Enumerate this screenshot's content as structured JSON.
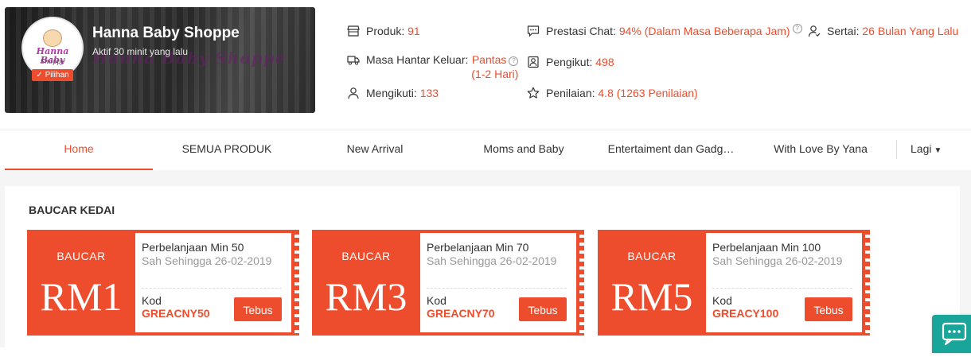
{
  "shop": {
    "name": "Hanna Baby Shoppe",
    "active_status": "Aktif 30 minit yang lalu",
    "badge": "Pilihan",
    "logo_text": "Hanna Baby",
    "logo_subtext": "Shoppe",
    "watermark": "Hanna Baby Shoppe"
  },
  "stats": {
    "products_label": "Produk:",
    "products_value": "91",
    "ship_label": "Masa Hantar Keluar:",
    "ship_value_1": "Pantas",
    "ship_value_2": "(1-2 Hari)",
    "following_label": "Mengikuti:",
    "following_value": "133",
    "chat_label": "Prestasi Chat:",
    "chat_value": "94% (Dalam Masa Beberapa Jam)",
    "followers_label": "Pengikut:",
    "followers_value": "498",
    "rating_label": "Penilaian:",
    "rating_value": "4.8 (1263 Penilaian)",
    "joined_label": "Sertai:",
    "joined_value": "26 Bulan Yang Lalu",
    "help_glyph": "?"
  },
  "nav": {
    "items": [
      "Home",
      "SEMUA PRODUK",
      "New Arrival",
      "Moms and Baby",
      "Entertaiment dan Gadg…",
      "With Love By Yana"
    ],
    "more": "Lagi",
    "more_caret": "▼"
  },
  "section": {
    "title": "BAUCAR KEDAI"
  },
  "vouchers": [
    {
      "label": "BAUCAR",
      "amount": "RM1",
      "min": "Perbelanjaan Min 50",
      "expiry": "Sah Sehingga 26-02-2019",
      "code_label": "Kod",
      "code": "GREACNY50",
      "button": "Tebus"
    },
    {
      "label": "BAUCAR",
      "amount": "RM3",
      "min": "Perbelanjaan Min 70",
      "expiry": "Sah Sehingga 26-02-2019",
      "code_label": "Kod",
      "code": "GREACNY70",
      "button": "Tebus"
    },
    {
      "label": "BAUCAR",
      "amount": "RM5",
      "min": "Perbelanjaan Min 100",
      "expiry": "Sah Sehingga 26-02-2019",
      "code_label": "Kod",
      "code": "GREACY100",
      "button": "Tebus"
    }
  ],
  "colors": {
    "accent": "#ee4d2d",
    "chat_fab": "#1aa59a"
  },
  "icons": {
    "products": "store-icon",
    "ship": "truck-icon",
    "following": "user-icon",
    "chat": "chat-bubble-icon",
    "followers": "followers-icon",
    "rating": "star-icon",
    "joined": "user-check-icon",
    "help": "question-circle-icon",
    "chat_fab": "chat-icon"
  }
}
